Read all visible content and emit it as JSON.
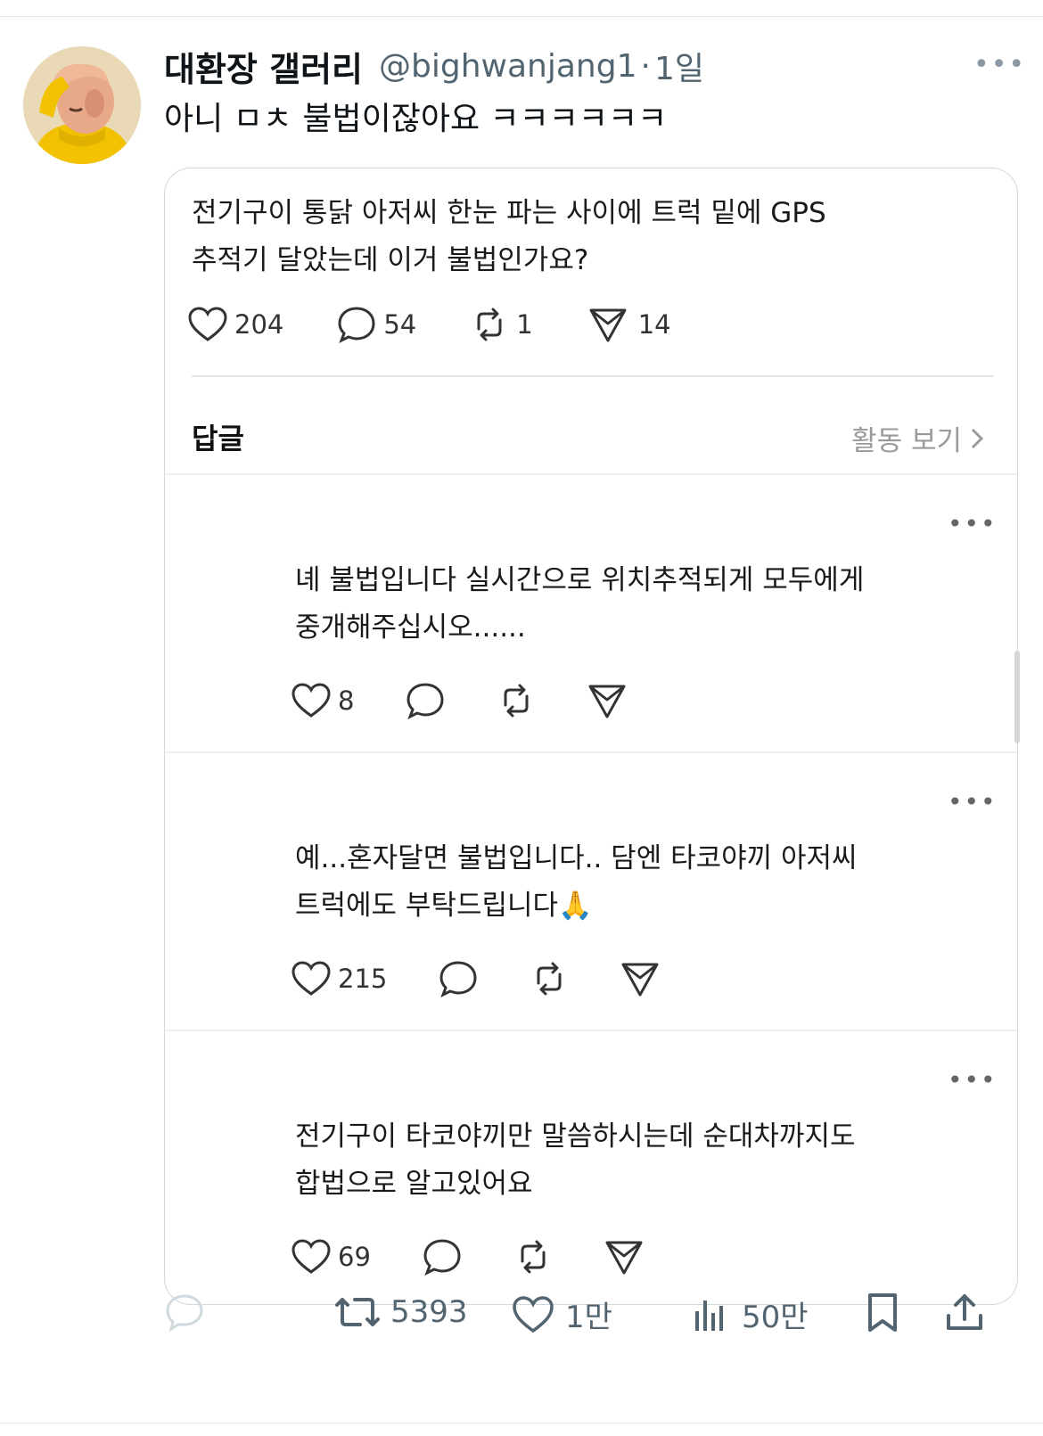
{
  "tweet": {
    "display_name": "대환장 갤러리",
    "handle": "@bighwanjang1",
    "separator": "·",
    "time": "1일",
    "text": "아니 ㅁㅊ 불법이잖아요 ㅋㅋㅋㅋㅋㅋ"
  },
  "quoted": {
    "text_line1": "전기구이 통닭 아저씨 한눈 파는 사이에 트럭 밑에 GPS",
    "text_line2": "추적기 달았는데 이거 불법인가요?",
    "likes": "204",
    "comments": "54",
    "reposts": "1",
    "shares": "14",
    "replies_label": "답글",
    "activity_label": "활동 보기",
    "replies": [
      {
        "line1": "녜 불법입니다 실시간으로 위치추적되게 모두에게",
        "line2": "중개해주십시오......",
        "likes": "8"
      },
      {
        "line1": "예...혼자달면 불법입니다.. 담엔 타코야끼 아저씨",
        "line2": "트럭에도 부탁드립니다🙏",
        "likes": "215"
      },
      {
        "line1": "전기구이 타코야끼만 말씀하시는데 순대차까지도",
        "line2": "합법으로 알고있어요",
        "likes": "69"
      }
    ]
  },
  "actions": {
    "retweets": "5393",
    "likes": "1만",
    "views": "50만"
  },
  "colors": {
    "text_primary": "#0f1419",
    "text_secondary": "#536471",
    "border": "#cfd9de",
    "avatar_yellow": "#f2c200"
  }
}
